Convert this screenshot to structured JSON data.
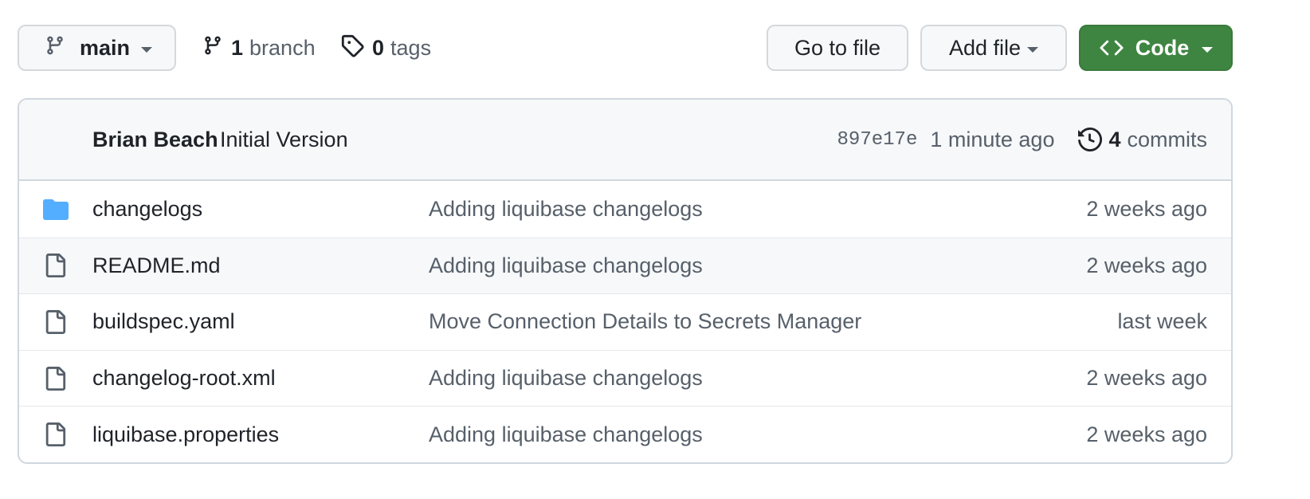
{
  "toolbar": {
    "branch_selector": {
      "label": "main",
      "icon": "git-branch-icon"
    },
    "branches": {
      "count": "1",
      "label": "branch",
      "icon": "git-branch-icon"
    },
    "tags": {
      "count": "0",
      "label": "tags",
      "icon": "tag-icon"
    },
    "go_to_file_label": "Go to file",
    "add_file_label": "Add file",
    "code_label": "Code",
    "code_color": "#3f8542"
  },
  "latest_commit": {
    "author": "Brian Beach",
    "message": "Initial Version",
    "sha": "897e17e",
    "time": "1 minute ago",
    "commits_count": "4",
    "commits_label": "commits"
  },
  "files": [
    {
      "type": "folder",
      "icon": "folder-icon",
      "name": "changelogs",
      "message": "Adding liquibase changelogs",
      "age": "2 weeks ago"
    },
    {
      "type": "file",
      "icon": "file-icon",
      "name": "README.md",
      "message": "Adding liquibase changelogs",
      "age": "2 weeks ago"
    },
    {
      "type": "file",
      "icon": "file-icon",
      "name": "buildspec.yaml",
      "message": "Move Connection Details to Secrets Manager",
      "age": "last week"
    },
    {
      "type": "file",
      "icon": "file-icon",
      "name": "changelog-root.xml",
      "message": "Adding liquibase changelogs",
      "age": "2 weeks ago"
    },
    {
      "type": "file",
      "icon": "file-icon",
      "name": "liquibase.properties",
      "message": "Adding liquibase changelogs",
      "age": "2 weeks ago"
    }
  ],
  "colors": {
    "folder": "#54aeff",
    "muted": "#57606a",
    "border": "#d0d7de"
  }
}
